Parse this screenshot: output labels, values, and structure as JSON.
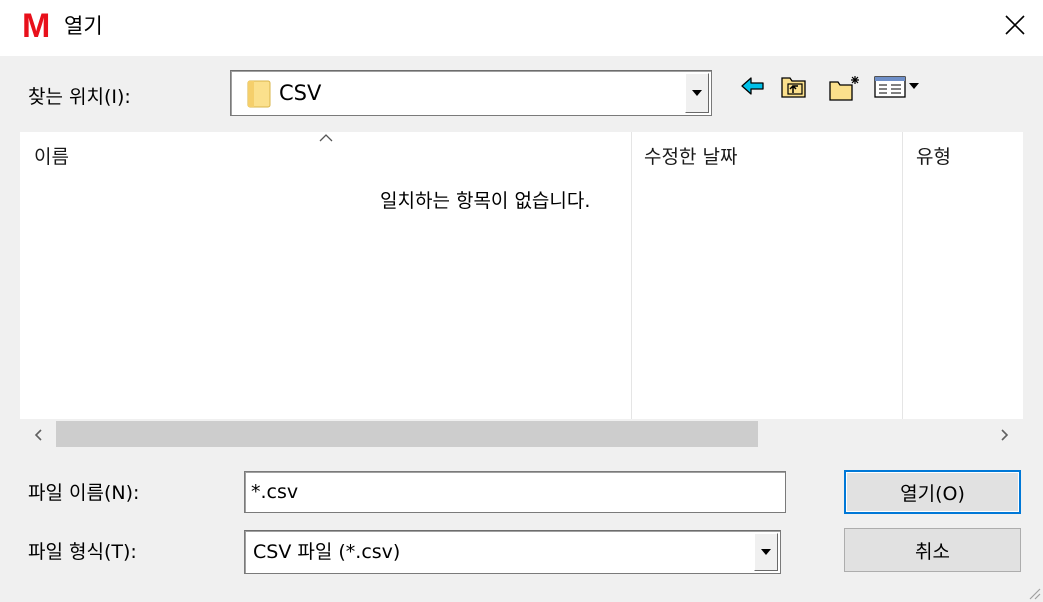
{
  "window": {
    "app_logo": "M",
    "title": "열기",
    "close_icon": "close-icon"
  },
  "location": {
    "label": "찾는 위치(I):",
    "value": "CSV",
    "icon": "folder-icon"
  },
  "toolbar": {
    "icons": [
      "back-arrow-icon",
      "up-folder-icon",
      "new-folder-icon",
      "view-menu-icon"
    ]
  },
  "file_list": {
    "columns": [
      "이름",
      "수정한 날짜",
      "유형"
    ],
    "empty_message": "일치하는 항목이 없습니다."
  },
  "filename": {
    "label": "파일 이름(N):",
    "value": "*.csv"
  },
  "filetype": {
    "label": "파일 형식(T):",
    "value": "CSV 파일 (*.csv)"
  },
  "buttons": {
    "open": "열기(O)",
    "cancel": "취소"
  },
  "colors": {
    "logo": "#e8101b",
    "focus_border": "#0078d7",
    "arrow_cyan": "#00c0e8",
    "folder_yellow": "#fbe08c"
  }
}
